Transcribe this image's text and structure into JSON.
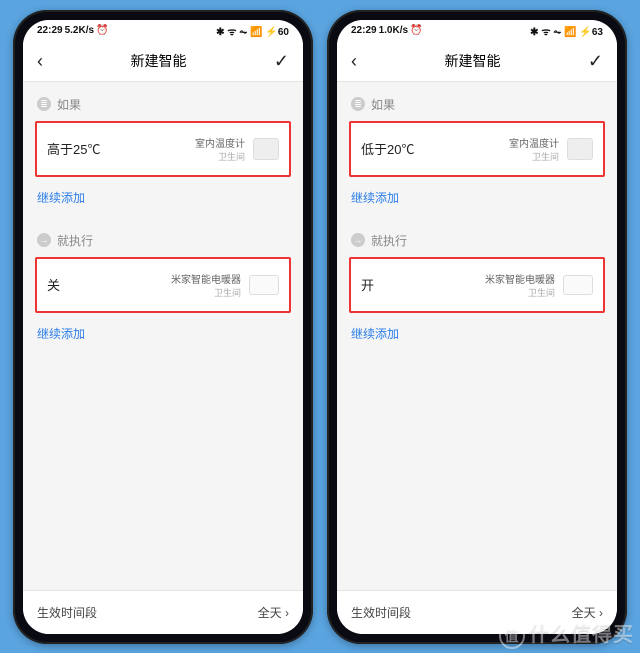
{
  "phones": [
    {
      "status": {
        "time": "22:29",
        "net": "5.2K/s",
        "alarm": "⏰",
        "right": "✱ ᯤ ⏦ 📶 ⚡60"
      },
      "header": {
        "title": "新建智能"
      },
      "if_label": "如果",
      "then_label": "就执行",
      "add_more": "继续添加",
      "condition": {
        "text": "高于25℃",
        "device": "室内温度计",
        "room": "卫生间"
      },
      "action": {
        "text": "关",
        "device": "米家智能电暖器",
        "room": "卫生间"
      },
      "bottom": {
        "label": "生效时间段",
        "value": "全天 ›"
      }
    },
    {
      "status": {
        "time": "22:29",
        "net": "1.0K/s",
        "alarm": "⏰",
        "right": "✱ ᯤ ⏦ 📶 ⚡63"
      },
      "header": {
        "title": "新建智能"
      },
      "if_label": "如果",
      "then_label": "就执行",
      "add_more": "继续添加",
      "condition": {
        "text": "低于20℃",
        "device": "室内温度计",
        "room": "卫生间"
      },
      "action": {
        "text": "开",
        "device": "米家智能电暖器",
        "room": "卫生间"
      },
      "bottom": {
        "label": "生效时间段",
        "value": "全天 ›"
      }
    }
  ],
  "watermark": "什么值得买"
}
